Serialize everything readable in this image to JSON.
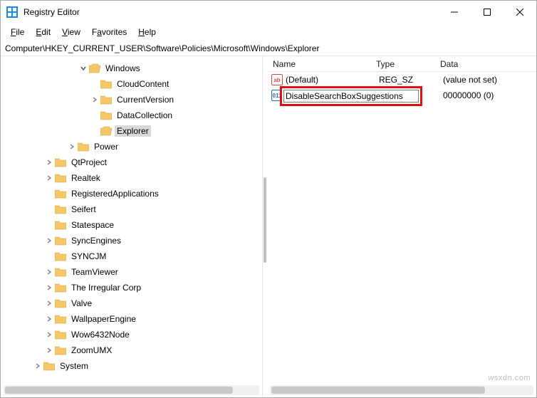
{
  "window": {
    "title": "Registry Editor"
  },
  "menu": {
    "file": "File",
    "edit": "Edit",
    "view": "View",
    "favorites": "Favorites",
    "help": "Help"
  },
  "address": "Computer\\HKEY_CURRENT_USER\\Software\\Policies\\Microsoft\\Windows\\Explorer",
  "tree": {
    "windows": "Windows",
    "cloudcontent": "CloudContent",
    "currentversion": "CurrentVersion",
    "datacollection": "DataCollection",
    "explorer": "Explorer",
    "power": "Power",
    "qtproject": "QtProject",
    "realtek": "Realtek",
    "regapps": "RegisteredApplications",
    "seifert": "Seifert",
    "statespace": "Statespace",
    "syncengines": "SyncEngines",
    "syncjm": "SYNCJM",
    "teamviewer": "TeamViewer",
    "irregular": "The Irregular Corp",
    "valve": "Valve",
    "wallpaper": "WallpaperEngine",
    "wow64": "Wow6432Node",
    "zoom": "ZoomUMX",
    "system": "System"
  },
  "columns": {
    "name": "Name",
    "type": "Type",
    "data": "Data"
  },
  "rows": {
    "default": {
      "name": "(Default)",
      "type": "REG_SZ",
      "data": "(value not set)",
      "icon": "ab"
    },
    "editing": {
      "name": "DisableSearchBoxSuggestions",
      "type_visible": "",
      "data": "00000000 (0)",
      "icon": "011"
    }
  },
  "watermark": "wsxdn.com"
}
